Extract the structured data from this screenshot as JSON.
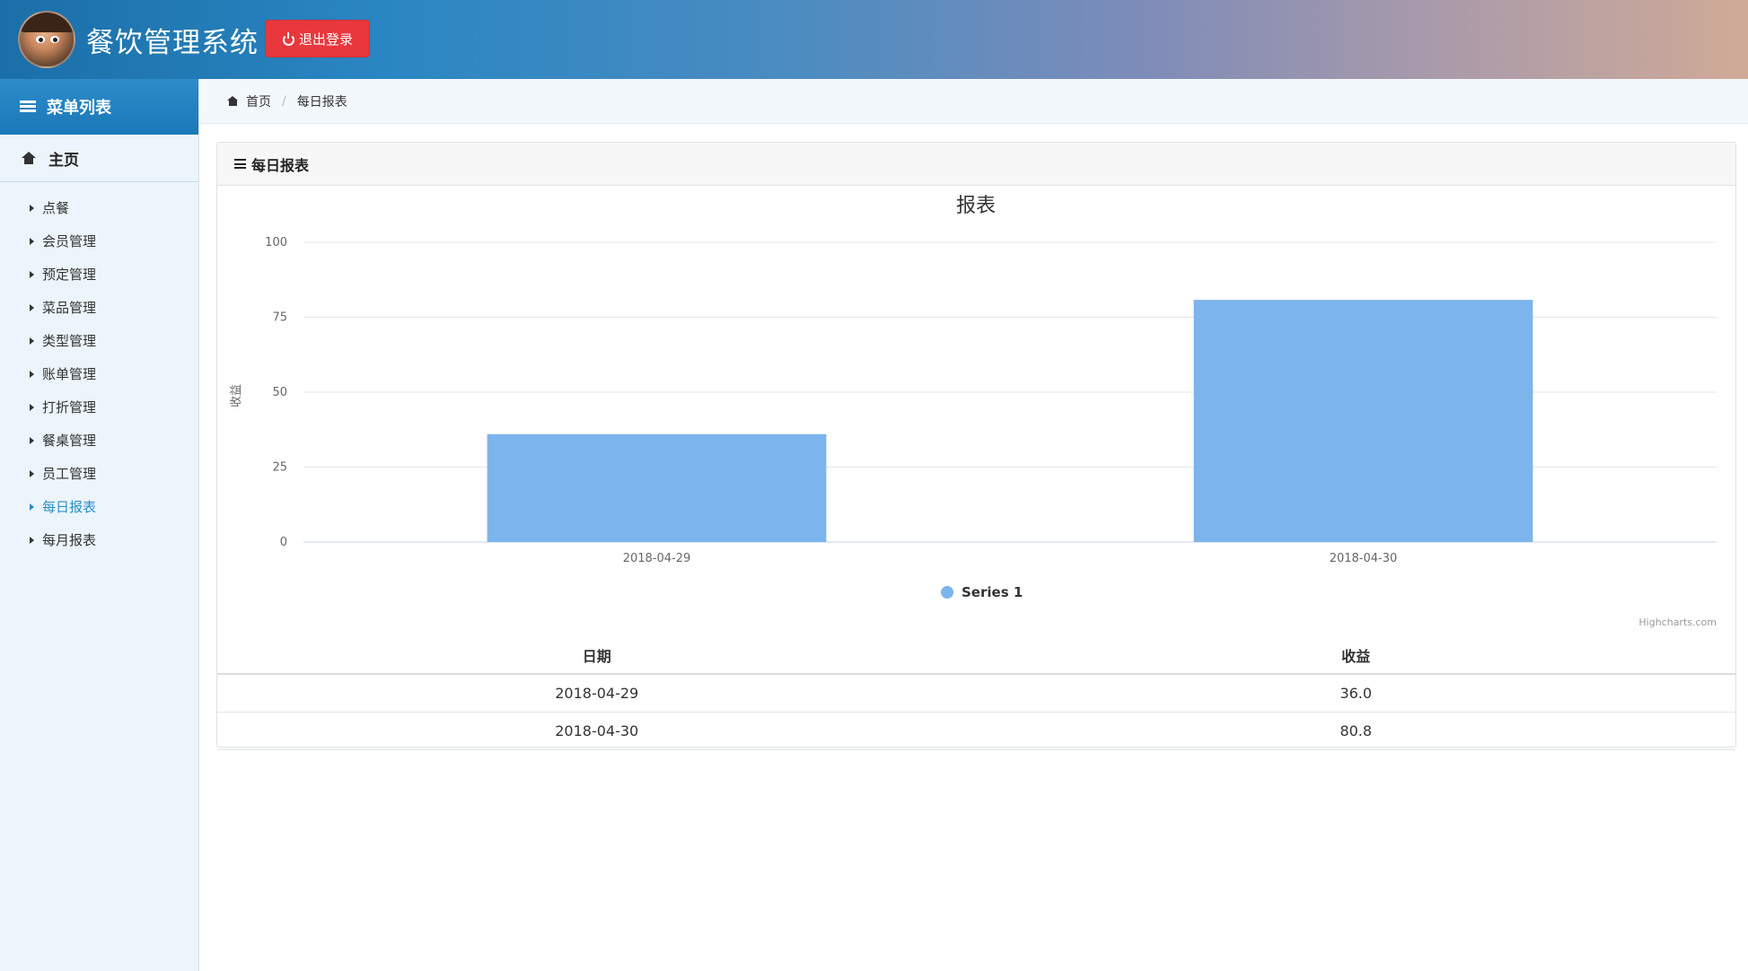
{
  "header": {
    "app_title": "餐饮管理系统",
    "logout_label": "退出登录",
    "logout_color": "#e8383d"
  },
  "sidebar": {
    "menu_title": "菜单列表",
    "home_label": "主页",
    "items": [
      {
        "label": "点餐",
        "active": false
      },
      {
        "label": "会员管理",
        "active": false
      },
      {
        "label": "预定管理",
        "active": false
      },
      {
        "label": "菜品管理",
        "active": false
      },
      {
        "label": "类型管理",
        "active": false
      },
      {
        "label": "账单管理",
        "active": false
      },
      {
        "label": "打折管理",
        "active": false
      },
      {
        "label": "餐桌管理",
        "active": false
      },
      {
        "label": "员工管理",
        "active": false
      },
      {
        "label": "每日报表",
        "active": true
      },
      {
        "label": "每月报表",
        "active": false
      }
    ],
    "active_color": "#2a8fc9"
  },
  "breadcrumb": {
    "home": "首页",
    "current": "每日报表"
  },
  "panel": {
    "title": "每日报表"
  },
  "chart_data": {
    "type": "bar",
    "title": "报表",
    "xlabel": "",
    "ylabel": "收益",
    "categories": [
      "2018-04-29",
      "2018-04-30"
    ],
    "series": [
      {
        "name": "Series 1",
        "values": [
          36.0,
          80.8
        ],
        "color": "#7cb5ec"
      }
    ],
    "ylim": [
      0,
      100
    ],
    "yticks": [
      0,
      25,
      50,
      75,
      100
    ],
    "grid": true,
    "legend": "bottom-center",
    "credits": "Highcharts.com"
  },
  "table": {
    "headers": [
      "日期",
      "收益"
    ],
    "rows": [
      [
        "2018-04-29",
        "36.0"
      ],
      [
        "2018-04-30",
        "80.8"
      ]
    ]
  }
}
